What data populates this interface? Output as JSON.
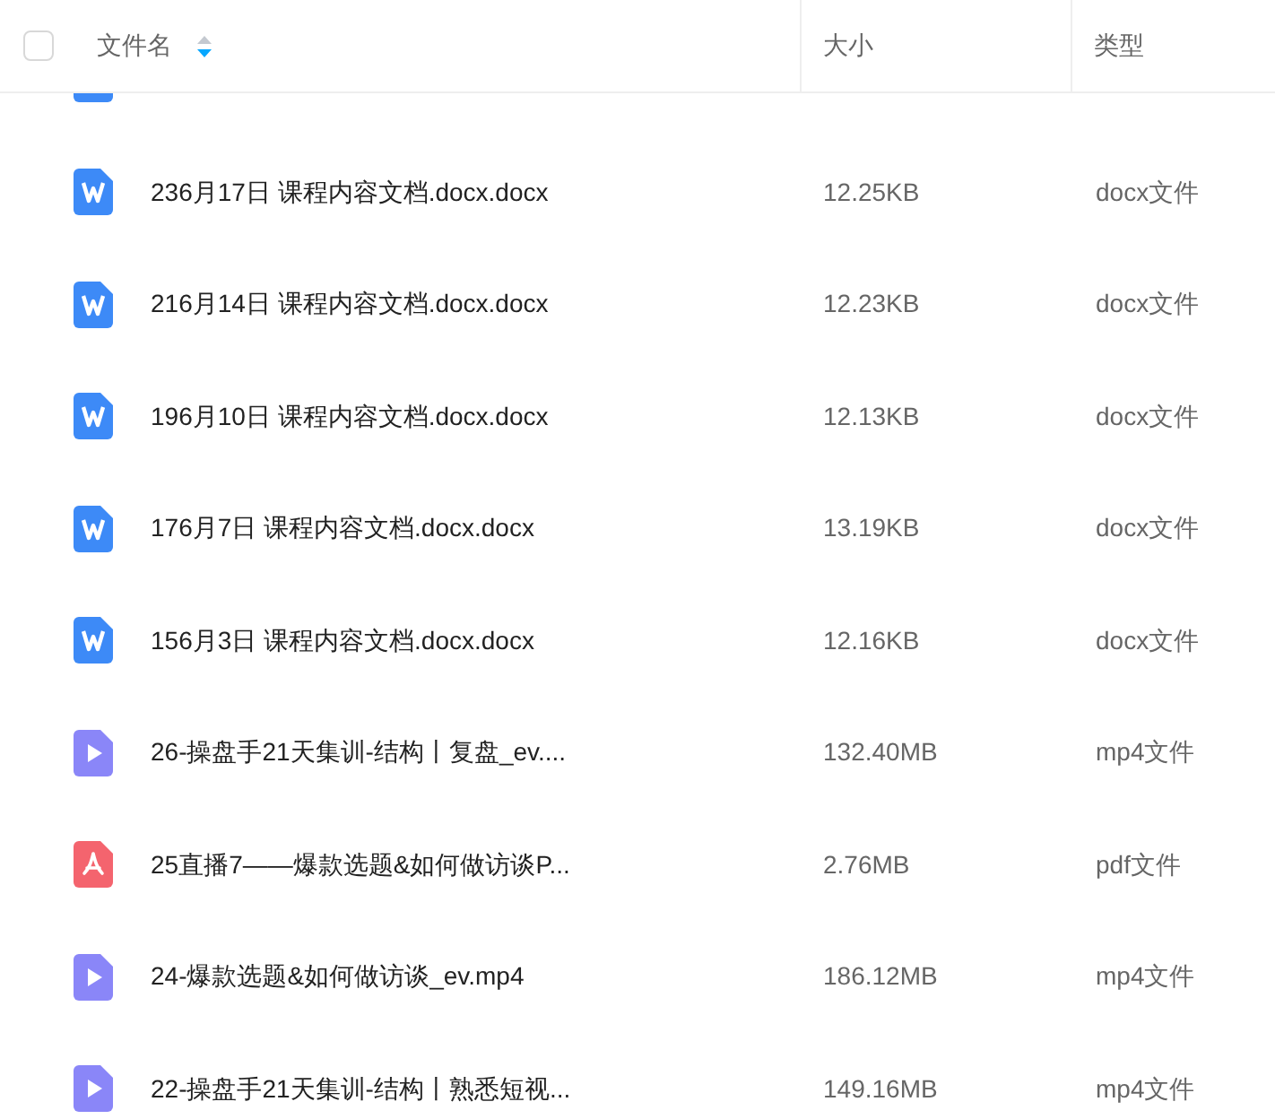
{
  "header": {
    "checked": false,
    "columns": [
      {
        "label": "文件名"
      },
      {
        "label": "大小"
      },
      {
        "label": "类型"
      }
    ],
    "sort_descending": true
  },
  "cut_off_row": {
    "kind": "docx"
  },
  "rows": [
    {
      "kind": "docx",
      "name": "236月17日 课程内容文档.docx.docx",
      "size": "12.25KB",
      "type": "docx文件"
    },
    {
      "kind": "docx",
      "name": "216月14日 课程内容文档.docx.docx",
      "size": "12.23KB",
      "type": "docx文件"
    },
    {
      "kind": "docx",
      "name": "196月10日 课程内容文档.docx.docx",
      "size": "12.13KB",
      "type": "docx文件"
    },
    {
      "kind": "docx",
      "name": "176月7日 课程内容文档.docx.docx",
      "size": "13.19KB",
      "type": "docx文件"
    },
    {
      "kind": "docx",
      "name": "156月3日 课程内容文档.docx.docx",
      "size": "12.16KB",
      "type": "docx文件"
    },
    {
      "kind": "mp4",
      "name": "26-操盘手21天集训-结构丨复盘_ev....",
      "size": "132.40MB",
      "type": "mp4文件"
    },
    {
      "kind": "pdf",
      "name": "25直播7——爆款选题&如何做访谈P...",
      "size": "2.76MB",
      "type": "pdf文件"
    },
    {
      "kind": "mp4",
      "name": "24-爆款选题&如何做访谈_ev.mp4",
      "size": "186.12MB",
      "type": "mp4文件"
    },
    {
      "kind": "mp4",
      "name": "22-操盘手21天集训-结构丨熟悉短视...",
      "size": "149.16MB",
      "type": "mp4文件"
    }
  ]
}
